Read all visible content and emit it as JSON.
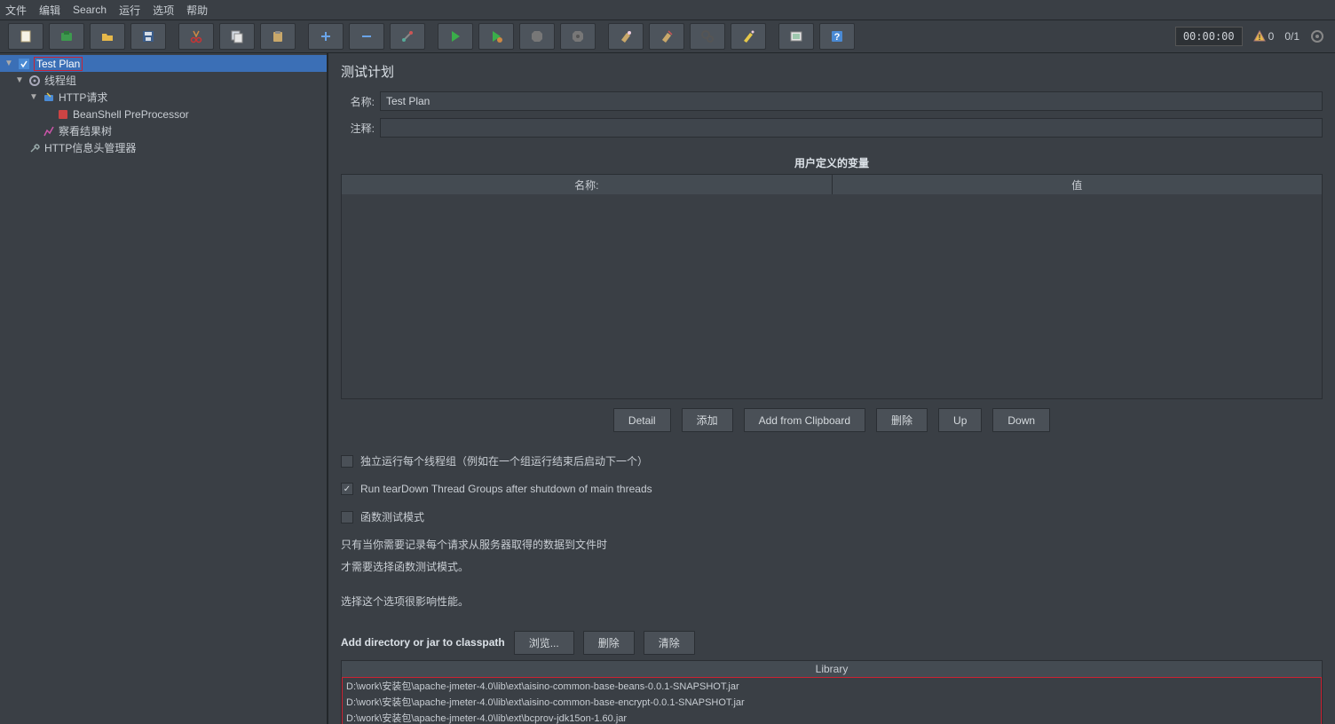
{
  "menu": {
    "file": "文件",
    "edit": "编辑",
    "search": "Search",
    "run": "运行",
    "options": "选项",
    "help": "帮助"
  },
  "toolbar": {
    "timer": "00:00:00",
    "warn_count": "0",
    "err_count": "0/1"
  },
  "tree": {
    "root": "Test Plan",
    "threadgroup": "线程组",
    "http": "HTTP请求",
    "beanshell": "BeanShell PreProcessor",
    "viewresults": "察看结果树",
    "headermgr": "HTTP信息头管理器"
  },
  "panel": {
    "title": "测试计划",
    "name_label": "名称:",
    "name_value": "Test Plan",
    "comment_label": "注释:",
    "comment_value": "",
    "vars_title": "用户定义的变量",
    "col_name": "名称:",
    "col_value": "值",
    "btn_detail": "Detail",
    "btn_add": "添加",
    "btn_clipboard": "Add from Clipboard",
    "btn_delete": "删除",
    "btn_up": "Up",
    "btn_down": "Down",
    "chk_serial": "独立运行每个线程组（例如在一个组运行结束后启动下一个）",
    "chk_teardown": "Run tearDown Thread Groups after shutdown of main threads",
    "chk_functest": "函数测试模式",
    "help1": "只有当你需要记录每个请求从服务器取得的数据到文件时",
    "help2": "才需要选择函数测试模式。",
    "help3": "选择这个选项很影响性能。",
    "classpath_label": "Add directory or jar to classpath",
    "btn_browse": "浏览...",
    "btn_del2": "删除",
    "btn_clear": "清除",
    "lib_header": "Library",
    "libs": [
      "D:\\work\\安装包\\apache-jmeter-4.0\\lib\\ext\\aisino-common-base-beans-0.0.1-SNAPSHOT.jar",
      "D:\\work\\安装包\\apache-jmeter-4.0\\lib\\ext\\aisino-common-base-encrypt-0.0.1-SNAPSHOT.jar",
      "D:\\work\\安装包\\apache-jmeter-4.0\\lib\\ext\\bcprov-jdk15on-1.60.jar"
    ]
  }
}
